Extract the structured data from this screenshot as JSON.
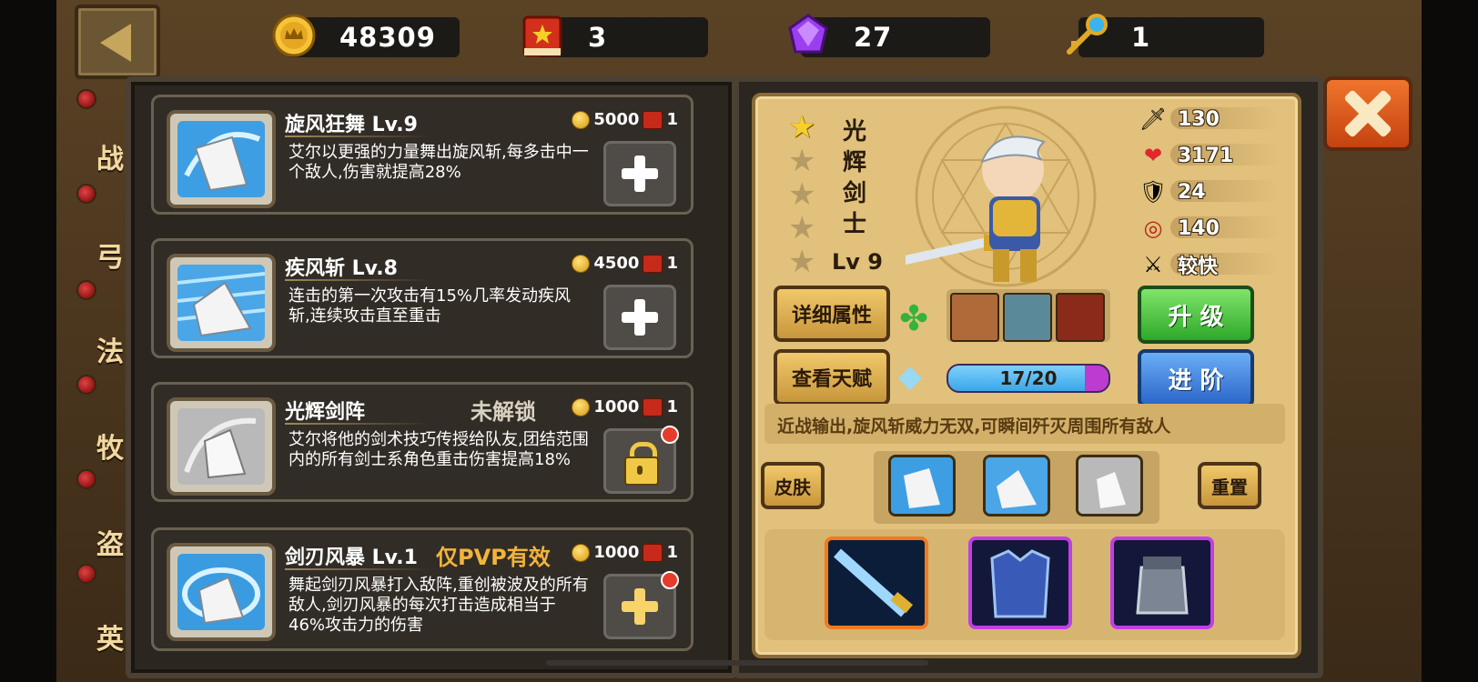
{
  "top_bar": {
    "gold": "48309",
    "books": "3",
    "gems": "27",
    "keys": "1"
  },
  "side_tabs": [
    "战",
    "弓",
    "法",
    "牧",
    "盗",
    "英"
  ],
  "skills": [
    {
      "title": "旋风狂舞 Lv.9",
      "desc": "艾尔以更强的力量舞出旋风斩,每多击中一个敌人,伤害就提高28%",
      "cost_gold": "5000",
      "cost_book": "1",
      "tag": "",
      "action": "plus",
      "dot": false
    },
    {
      "title": "疾风斩 Lv.8",
      "desc": "连击的第一次攻击有15%几率发动疾风斩,连续攻击直至重击",
      "cost_gold": "4500",
      "cost_book": "1",
      "tag": "",
      "action": "plus",
      "dot": false
    },
    {
      "title": "光辉剑阵",
      "desc": "艾尔将他的剑术技巧传授给队友,团结范围内的所有剑士系角色重击伤害提高18%",
      "cost_gold": "1000",
      "cost_book": "1",
      "tag": "未解锁",
      "action": "lock",
      "dot": true
    },
    {
      "title": "剑刃风暴 Lv.1",
      "desc": "舞起剑刃风暴打入敌阵,重创被波及的所有敌人,剑刃风暴的每次打击造成相当于46%攻击力的伤害",
      "cost_gold": "1000",
      "cost_book": "1",
      "tag": "仅PVP有效",
      "action": "plus-gold",
      "dot": true
    }
  ],
  "hero": {
    "name_chars": [
      "光",
      "辉",
      "剑",
      "士"
    ],
    "level": "Lv 9",
    "stars_on": 1,
    "stars_total": 5,
    "stats": [
      {
        "icon": "sword-icon",
        "value": "130"
      },
      {
        "icon": "heart-icon",
        "value": "3171"
      },
      {
        "icon": "armor-icon",
        "value": "24"
      },
      {
        "icon": "target-icon",
        "value": "140"
      },
      {
        "icon": "speed-icon",
        "value": "较快"
      }
    ],
    "description": "近战输出,旋风斩威力无双,可瞬间歼灭周围所有敌人",
    "progress_text": "17/20",
    "progress_fraction": 0.85
  },
  "buttons": {
    "details": "详细属性",
    "talent": "查看天赋",
    "upgrade": "升 级",
    "advance": "进 阶",
    "skin": "皮肤",
    "reset": "重置"
  }
}
